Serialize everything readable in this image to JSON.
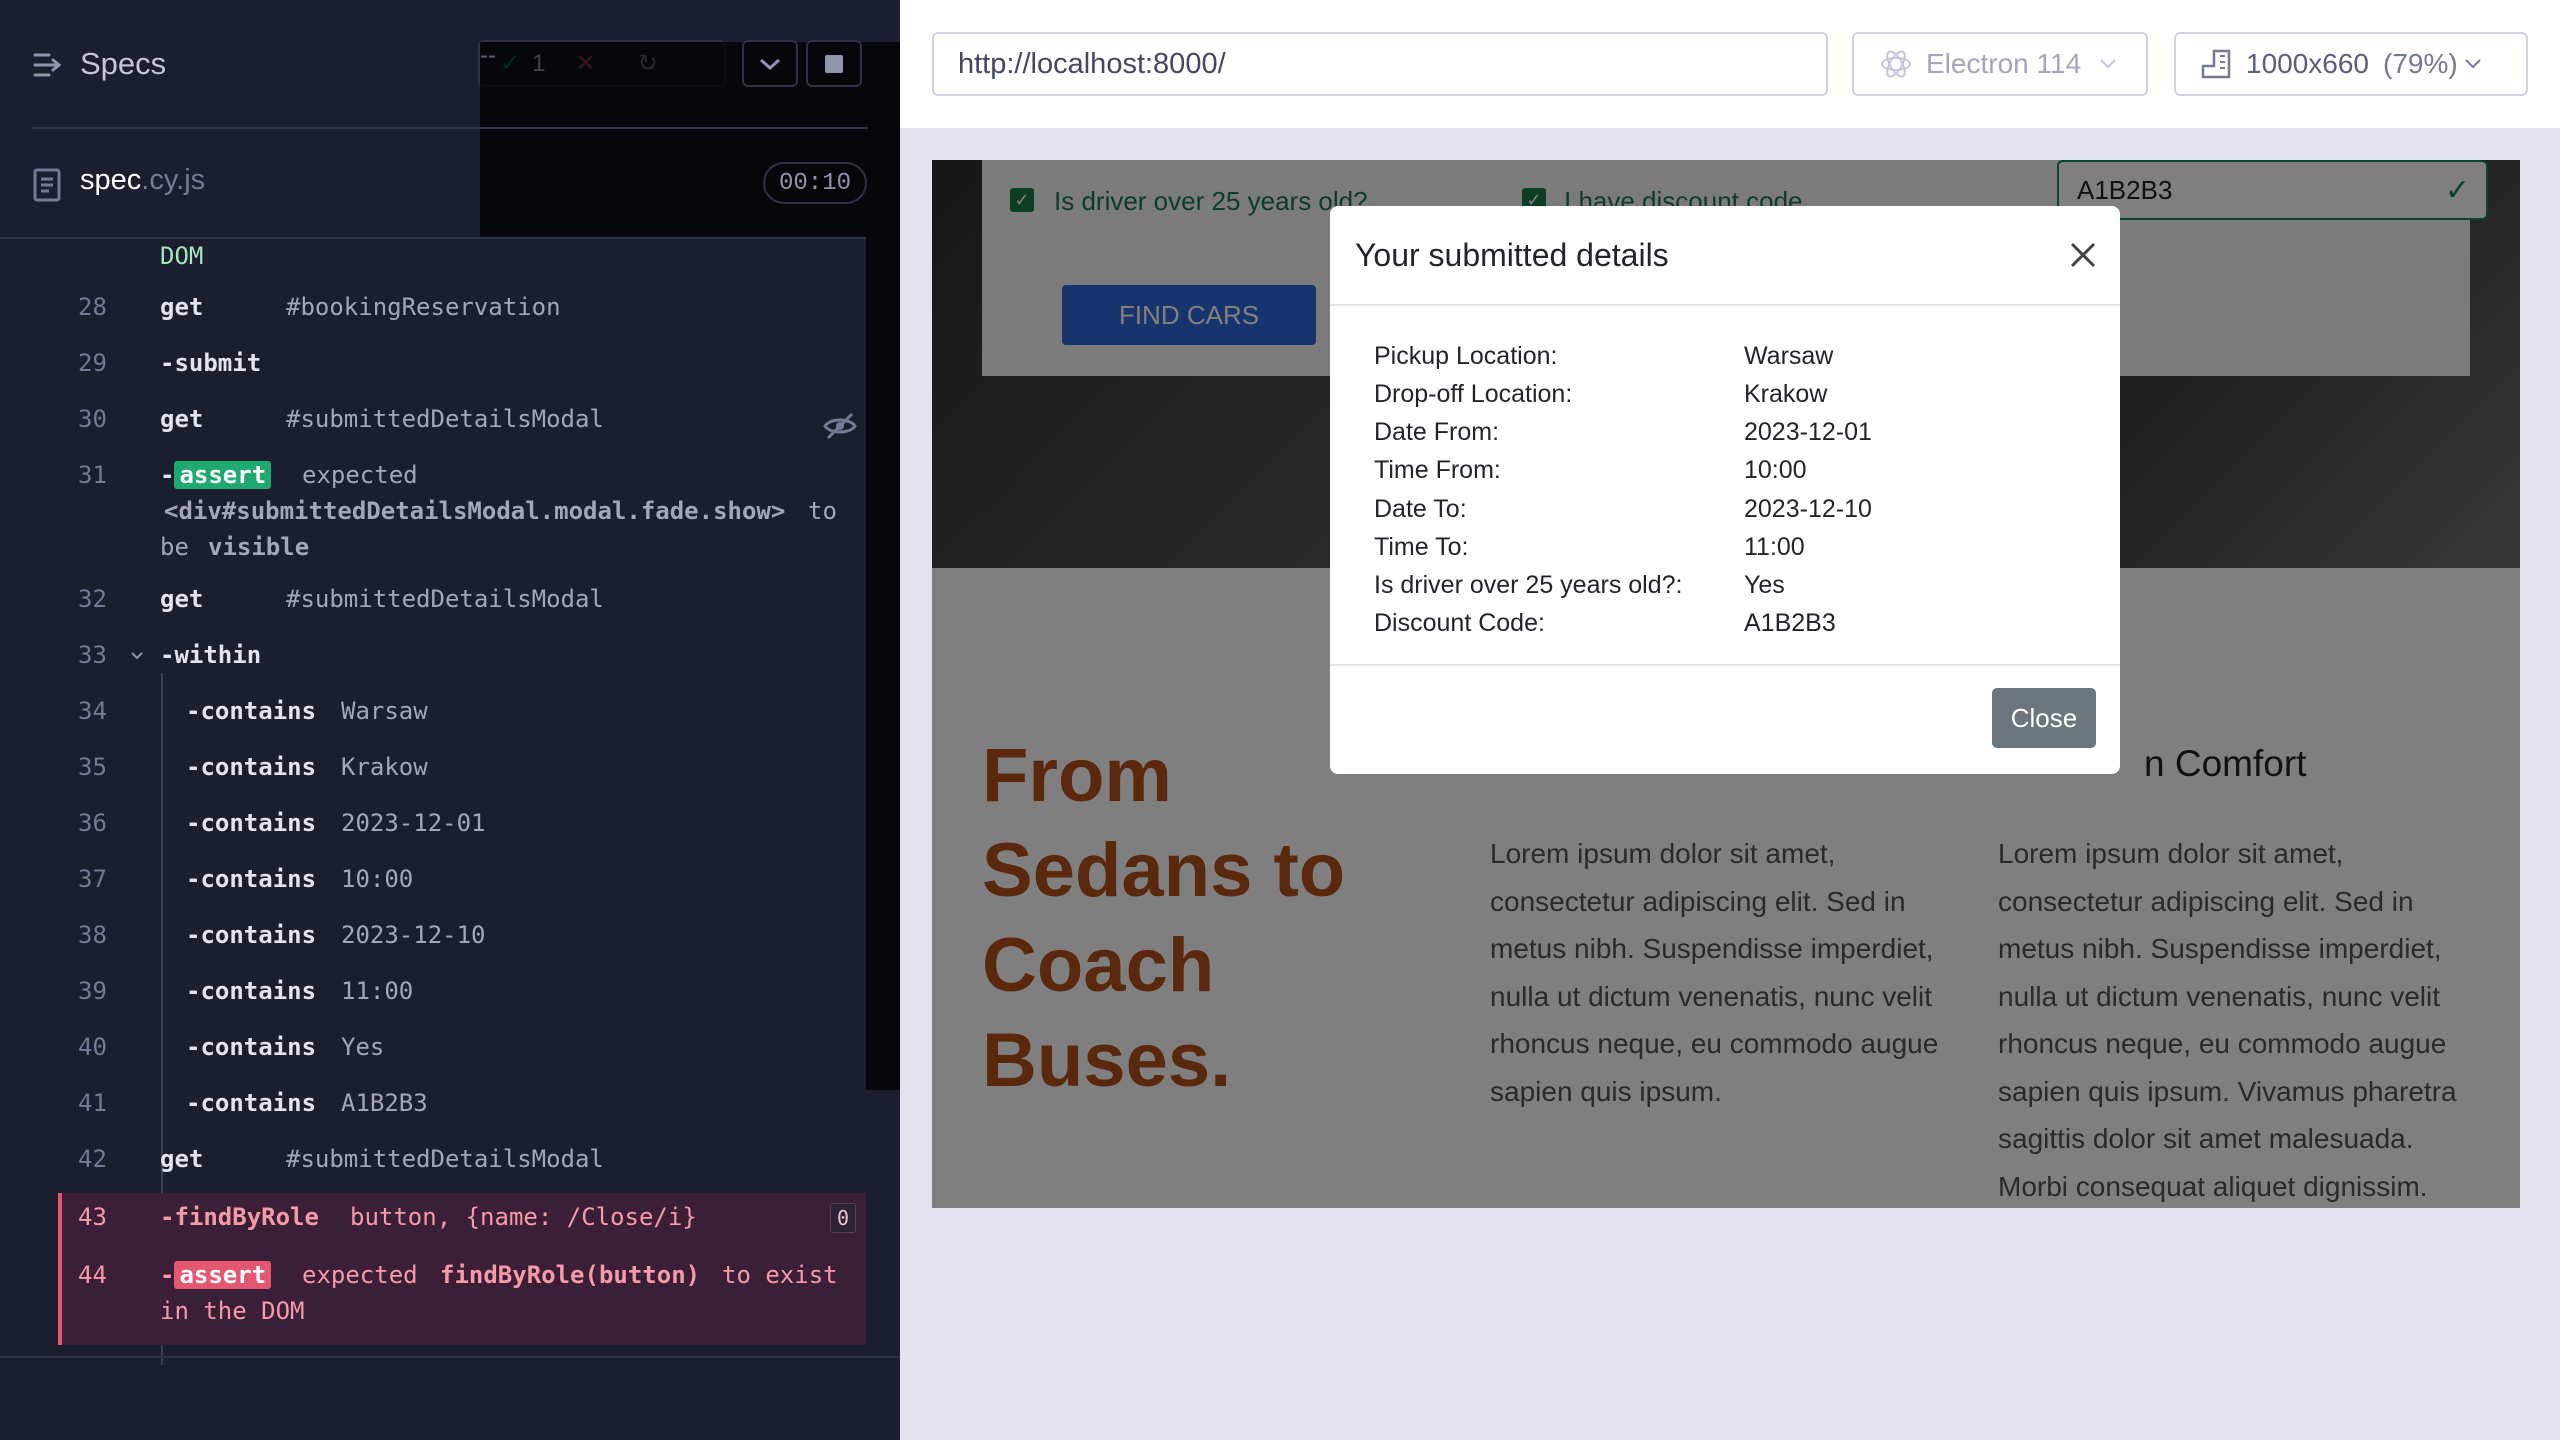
{
  "cypress": {
    "specs_title": "Specs",
    "stats": {
      "passed": "1",
      "failed": "--",
      "pending": "--"
    },
    "spec": {
      "name": "spec",
      "ext": ".cy.js",
      "timer": "00:10"
    },
    "log_top": "DOM",
    "commands": [
      {
        "n": "28",
        "cmd": "get",
        "msg": "#bookingReservation"
      },
      {
        "n": "29",
        "cmd": "-submit",
        "msg": ""
      },
      {
        "n": "30",
        "cmd": "get",
        "msg": "#submittedDetailsModal"
      },
      {
        "n": "31",
        "badge": "assert",
        "l1": "expected",
        "l2": "<div#submittedDetailsModal.modal.fade.show>",
        "l2b": "to",
        "l3": "be",
        "l3b": "visible"
      },
      {
        "n": "32",
        "cmd": "get",
        "msg": "#submittedDetailsModal"
      },
      {
        "n": "33",
        "cmd": "-within",
        "msg": ""
      },
      {
        "n": "34",
        "cmd": "-contains",
        "msg": "Warsaw"
      },
      {
        "n": "35",
        "cmd": "-contains",
        "msg": "Krakow"
      },
      {
        "n": "36",
        "cmd": "-contains",
        "msg": "2023-12-01"
      },
      {
        "n": "37",
        "cmd": "-contains",
        "msg": "10:00"
      },
      {
        "n": "38",
        "cmd": "-contains",
        "msg": "2023-12-10"
      },
      {
        "n": "39",
        "cmd": "-contains",
        "msg": "11:00"
      },
      {
        "n": "40",
        "cmd": "-contains",
        "msg": "Yes"
      },
      {
        "n": "41",
        "cmd": "-contains",
        "msg": "A1B2B3"
      },
      {
        "n": "42",
        "cmd": "get",
        "msg": "#submittedDetailsModal"
      },
      {
        "n": "43",
        "cmd": "-findByRole",
        "msg": "button, {name: /Close/i}",
        "count": "0"
      },
      {
        "n": "44",
        "badge": "assert",
        "l1": "expected",
        "l1b": "findByRole(button)",
        "l1c": "to exist",
        "l2": "in the DOM"
      }
    ]
  },
  "browser": {
    "url": "http://localhost:8000/",
    "browser_name": "Electron 114",
    "viewport": "1000x660",
    "zoom": "(79%)"
  },
  "app": {
    "driver_label": "Is driver over 25 years old?",
    "discount_label": "I have discount code",
    "discount_value": "A1B2B3",
    "find_button": "FIND CARS",
    "headline": "From Sedans to Coach Buses.",
    "col2_heading": "Comfort",
    "lorem1": "Lorem ipsum dolor sit amet, consectetur adipiscing elit. Sed in metus nibh. Suspendisse imperdiet, nulla ut dictum venenatis, nunc velit rhoncus neque, eu commodo augue sapien quis ipsum.",
    "lorem2": "Lorem ipsum dolor sit amet, consectetur adipiscing elit. Sed in metus nibh. Suspendisse imperdiet, nulla ut dictum venenatis, nunc velit rhoncus neque, eu commodo augue sapien quis ipsum. Vivamus pharetra sagittis dolor sit amet malesuada. Morbi consequat aliquet dignissim."
  },
  "modal": {
    "title": "Your submitted details",
    "rows": [
      {
        "k": "Pickup Location:",
        "v": "Warsaw"
      },
      {
        "k": "Drop-off Location:",
        "v": "Krakow"
      },
      {
        "k": "Date From:",
        "v": "2023-12-01"
      },
      {
        "k": "Time From:",
        "v": "10:00"
      },
      {
        "k": "Date To:",
        "v": "2023-12-10"
      },
      {
        "k": "Time To:",
        "v": "11:00"
      },
      {
        "k": "Is driver over 25 years old?:",
        "v": "Yes"
      },
      {
        "k": "Discount Code:",
        "v": "A1B2B3"
      }
    ],
    "close_label": "Close"
  }
}
